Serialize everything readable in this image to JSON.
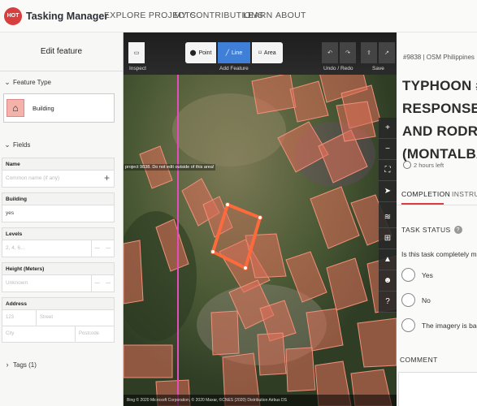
{
  "nav": {
    "logo_text": "HOT",
    "brand": "Tasking Manager",
    "links": [
      "EXPLORE PROJECTS",
      "MY CONTRIBUTIONS",
      "LEARN",
      "ABOUT"
    ]
  },
  "sidebar": {
    "header": "Edit feature",
    "feature_type_title": "Feature Type",
    "preset_label": "Building",
    "fields_title": "Fields",
    "fields": {
      "name_label": "Name",
      "name_placeholder": "Common name (if any)",
      "building_label": "Building",
      "building_value": "yes",
      "levels_label": "Levels",
      "levels_placeholder": "2, 4, 6...",
      "height_label": "Height (Meters)",
      "height_placeholder": "Unknown",
      "address_label": "Address",
      "addr_number": "123",
      "addr_street": "Street",
      "addr_city": "City",
      "addr_postcode": "Postcode"
    },
    "tags_title": "Tags (1)"
  },
  "map": {
    "inspect_label": "Inspect",
    "add_feature_label": "Add Feature",
    "undo_redo_label": "Undo / Redo",
    "save_label": "Save",
    "modes": [
      "Point",
      "Line",
      "Area"
    ],
    "edit_warning": "project 9838. Do not edit outside of this area!",
    "attribution": "Bing © 2020 Microsoft Corporation, © 2020 Maxar, ©CNES (2020) Distribution Airbus DS",
    "side_controls": [
      "zoom-in",
      "zoom-out",
      "fullscreen",
      "locate",
      "layers",
      "map-data",
      "issues",
      "preferences",
      "help"
    ]
  },
  "task": {
    "project_line": "#9838 | OSM Philippines",
    "title_lines": [
      "TYPHOON #UL",
      "RESPONSE – S",
      "AND RODRIGUE",
      "(MONTALBAN),"
    ],
    "time_left": "2 hours left",
    "tabs": [
      "COMPLETION",
      "INSTRUCTIONS"
    ],
    "status_title": "TASK STATUS",
    "question": "Is this task completely mapped?",
    "options": [
      "Yes",
      "No",
      "The imagery is bad"
    ],
    "comment_title": "COMMENT"
  },
  "colors": {
    "accent": "#d73f3f",
    "active_mode": "#3f7fd8",
    "building_fill": "#e0705a",
    "selected_outline": "#ff6a3d",
    "boundary": "#e64cc0"
  }
}
